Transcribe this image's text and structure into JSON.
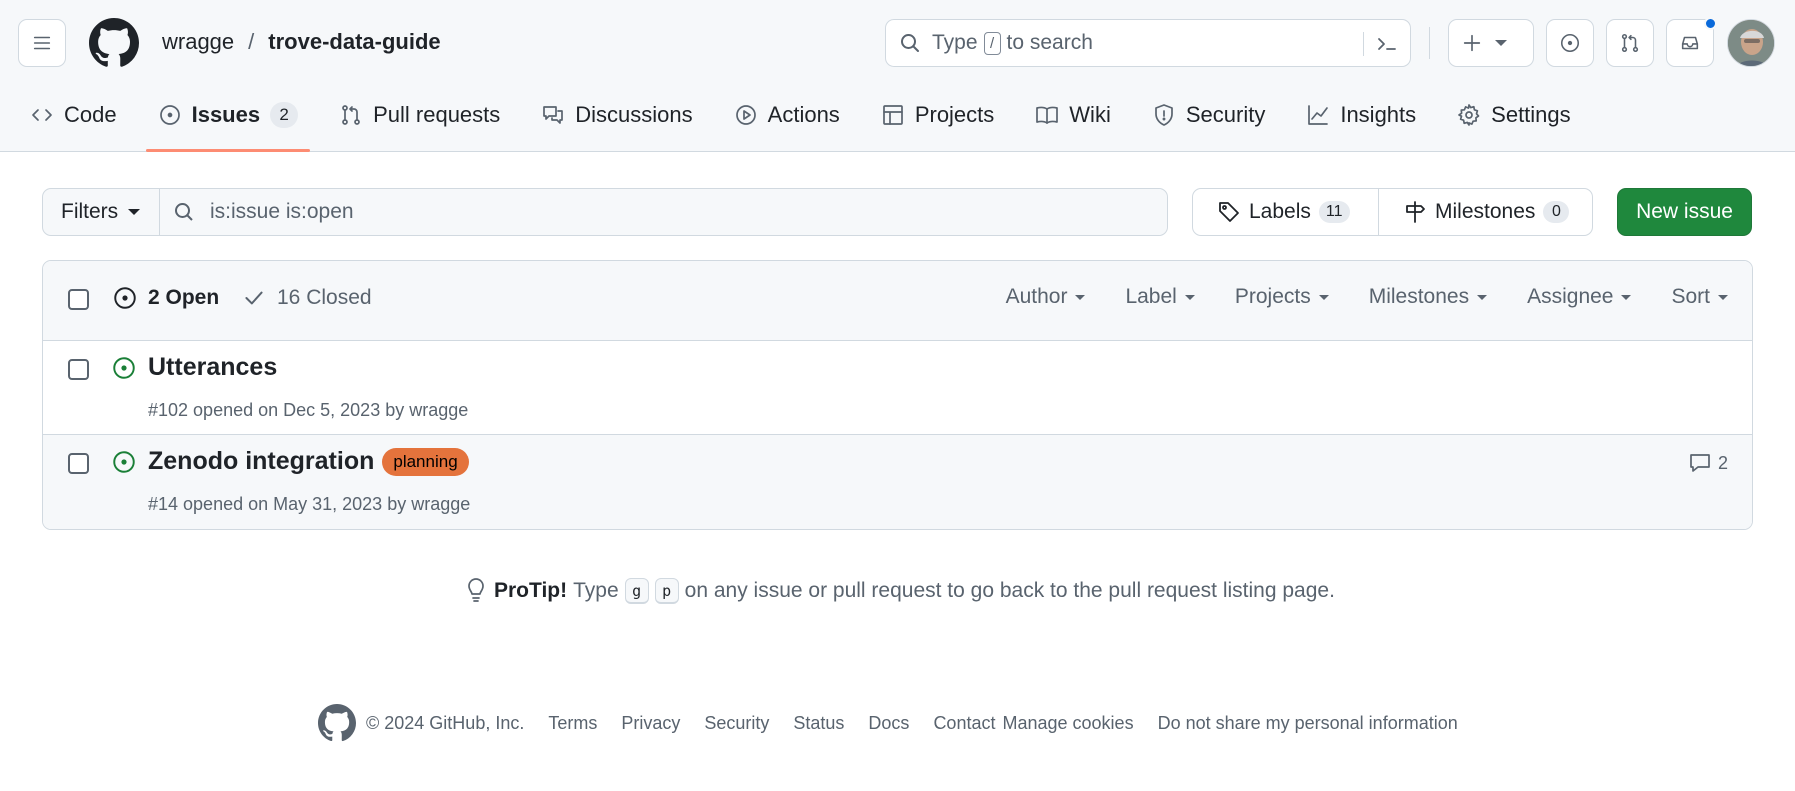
{
  "header": {
    "owner": "wragge",
    "separator": "/",
    "repo": "trove-data-guide",
    "search_prefix": "Type",
    "search_key": "/",
    "search_suffix": "to search"
  },
  "nav": {
    "code": "Code",
    "issues": "Issues",
    "issues_count": "2",
    "pull_requests": "Pull requests",
    "discussions": "Discussions",
    "actions": "Actions",
    "projects": "Projects",
    "wiki": "Wiki",
    "security": "Security",
    "insights": "Insights",
    "settings": "Settings"
  },
  "subnav": {
    "filters_label": "Filters",
    "query": "is:issue is:open",
    "labels_label": "Labels",
    "labels_count": "11",
    "milestones_label": "Milestones",
    "milestones_count": "0",
    "new_issue_label": "New issue"
  },
  "issues_header": {
    "open_label": "2 Open",
    "closed_label": "16 Closed",
    "filters": [
      "Author",
      "Label",
      "Projects",
      "Milestones",
      "Assignee",
      "Sort"
    ]
  },
  "issues": [
    {
      "title": "Utterances",
      "meta": "#102 opened on Dec 5, 2023 by wragge"
    },
    {
      "title": "Zenodo integration",
      "label": "planning",
      "meta": "#14 opened on May 31, 2023 by wragge",
      "comments": "2"
    }
  ],
  "protip": {
    "lead": "ProTip!",
    "type_word": "Type",
    "key1": "g",
    "key2": "p",
    "rest": "on any issue or pull request to go back to the pull request listing page."
  },
  "footer": {
    "copyright": "© 2024 GitHub, Inc.",
    "links": [
      "Terms",
      "Privacy",
      "Security",
      "Status",
      "Docs",
      "Contact",
      "Manage cookies",
      "Do not share my personal information"
    ]
  },
  "colors": {
    "accent_green": "#1f883d",
    "open_green": "#1a7f37",
    "tab_underline": "#fd8c73",
    "label_planning": "#e4733c",
    "notification_blue": "#0969da"
  }
}
